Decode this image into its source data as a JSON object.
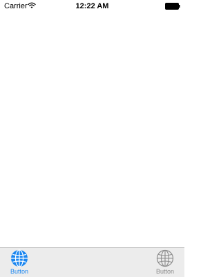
{
  "status_bar": {
    "carrier": "Carrier",
    "time": "12:22 AM",
    "wifi_icon": "wifi-icon",
    "battery_icon": "battery-icon"
  },
  "tab_bar": {
    "items": [
      {
        "label": "Button",
        "icon": "globe-icon",
        "selected": true,
        "color": "#1a86f0"
      },
      {
        "label": "Button",
        "icon": "globe-icon",
        "selected": false,
        "color": "#8a8a8a"
      }
    ]
  }
}
